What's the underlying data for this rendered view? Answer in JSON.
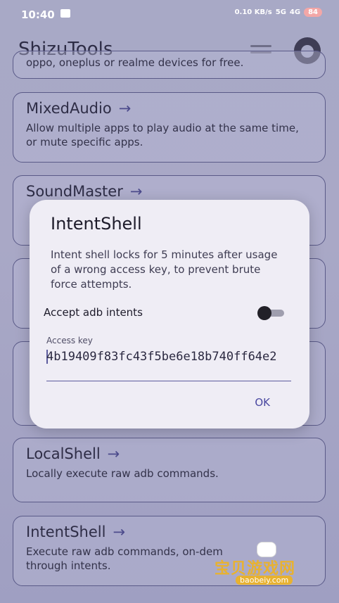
{
  "status": {
    "time": "10:40",
    "net_speed": "0.10 KB/s",
    "signal1": "5G",
    "signal2": "4G",
    "battery": "84"
  },
  "appbar": {
    "title": "ShizuTools",
    "menu_icon": "menu-icon",
    "github_icon": "github-icon"
  },
  "cards": [
    {
      "title": "",
      "desc": "oppo, oneplus or realme devices for free."
    },
    {
      "title": "MixedAudio",
      "desc": "Allow multiple apps to play audio at the same time, or mute specific apps."
    },
    {
      "title": "SoundMaster",
      "desc": ""
    },
    {
      "title": "LocalShell",
      "desc": "Locally execute raw adb commands."
    },
    {
      "title": "IntentShell",
      "desc": "Execute raw adb commands, on-dem through intents."
    }
  ],
  "dialog": {
    "title": "IntentShell",
    "message": "Intent shell locks for 5 minutes after usage of a wrong access key, to prevent brute force attempts.",
    "switch_label": "Accept adb intents",
    "switch_on": false,
    "field_label": "Access key",
    "field_value": "4b19409f83fc43f5be6e18b740ff64e2",
    "ok_label": "OK"
  },
  "watermark": {
    "main": "宝贝游戏网",
    "url": "baobeiy.com"
  },
  "colors": {
    "accent": "#4a48a0",
    "background": "#a8a9c6",
    "dialog_bg": "#efedf5"
  }
}
